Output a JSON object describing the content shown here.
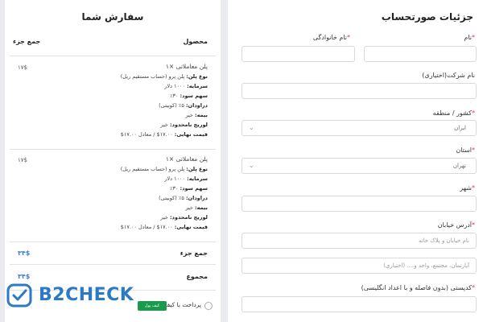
{
  "billing": {
    "title": "جزئیات صورتحساب",
    "first_name_label": "نام",
    "last_name_label": "نام خانوادگی",
    "company_label": "نام شرکت(اختیاری)",
    "country_label": "کشور / منطقه",
    "country_value": "ایران",
    "state_label": "استان",
    "state_value": "تهران",
    "city_label": "شهر",
    "address_label": "آدرس خیابان",
    "address1_placeholder": "نام خیابان و پلاک خانه",
    "address2_placeholder": "آپارتمان، مجتمع، واحد و.... (اختیاری)",
    "postcode_label": "کدپستی (بدون فاصله و با اعداد انگلیسی)",
    "required_mark": "*"
  },
  "order": {
    "title": "سفارش شما",
    "col_product": "محصول",
    "col_subtotal": "جمع جزء",
    "items": [
      {
        "name": "پلن معاملاتی ×۱",
        "plan_label": "نوع پلن:",
        "plan_value": "پلن پرو (حساب مستقیم ریل)",
        "capital_label": "سرمایه:",
        "capital_value": "۱۰۰۰ دلار",
        "profit_label": "سهم سود:",
        "profit_value": "۳۰٪",
        "drawdown_label": "دراودان:",
        "drawdown_value": "۵٪ (کوبیتی)",
        "insurance_label": "بیمه:",
        "insurance_value": "خیر",
        "unlimited_label": "لوریج نامحدود:",
        "unlimited_value": "خیر",
        "final_label": "قیمت نهایی:",
        "final_value": "۱۷.۰۰$ / معادل ۱۷.۰۰$",
        "price": "۱۷$"
      },
      {
        "name": "پلن معاملاتی ×۱",
        "plan_label": "نوع پلن:",
        "plan_value": "پلن پرو (حساب مستقیم ریل)",
        "capital_label": "سرمایه:",
        "capital_value": "۱۰۰۰ دلار",
        "profit_label": "سهم سود:",
        "profit_value": "۳۰٪",
        "drawdown_label": "دراودان:",
        "drawdown_value": "۵٪ (کوبیتی)",
        "insurance_label": "بیمه:",
        "insurance_value": "خیر",
        "unlimited_label": "لوریج نامحدود:",
        "unlimited_value": "خیر",
        "final_label": "قیمت نهایی:",
        "final_value": "۱۷.۰۰$ / معادل ۱۷.۰۰$",
        "price": "۱۷$"
      }
    ],
    "subtotal_label": "جمع جزء",
    "subtotal_value": "۳۴$",
    "total_label": "مجموع",
    "total_value": "۳۴$",
    "wallet_label": "پرداخت با کیف پول",
    "wallet_badge": "کیف پول"
  },
  "brand": {
    "logo_text": "B2CHECK",
    "accent": "#3d7fd8",
    "required": "#e0334a"
  }
}
